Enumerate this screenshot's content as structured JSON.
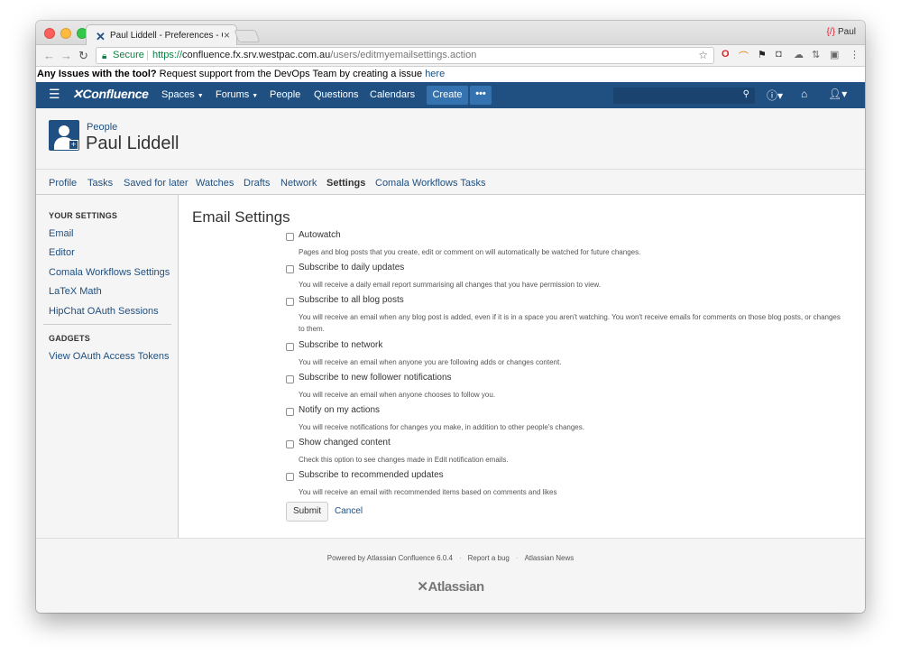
{
  "browser": {
    "tab_title": "Paul Liddell - Preferences - Co",
    "tab_close": "×",
    "profile_name": "Paul",
    "secure_label": "Secure",
    "url_scheme": "https://",
    "url_host": "confluence.fx.srv.westpac.com.au",
    "url_path": "/users/editmyemailsettings.action"
  },
  "banner": {
    "bold": "Any Issues with the tool?",
    "text": " Request support from the DevOps Team by creating a issue ",
    "link": "here"
  },
  "header": {
    "logo": "Confluence",
    "nav": [
      {
        "label": "Spaces",
        "caret": "▼"
      },
      {
        "label": "Forums",
        "caret": "▼"
      },
      {
        "label": "People"
      },
      {
        "label": "Questions"
      },
      {
        "label": "Calendars"
      }
    ],
    "create": "Create",
    "more": "•••",
    "search_placeholder": ""
  },
  "page": {
    "breadcrumb": "People",
    "title": "Paul Liddell"
  },
  "tabs": [
    "Profile",
    "Tasks",
    "Saved for later",
    "Watches",
    "Drafts",
    "Network",
    "Settings",
    "Comala Workflows Tasks"
  ],
  "active_tab": "Settings",
  "sidebar": {
    "settings_heading": "YOUR SETTINGS",
    "settings_links": [
      "Email",
      "Editor",
      "Comala Workflows Settings",
      "LaTeX Math",
      "HipChat OAuth Sessions"
    ],
    "gadgets_heading": "GADGETS",
    "gadgets_links": [
      "View OAuth Access Tokens"
    ]
  },
  "email_settings": {
    "heading": "Email Settings",
    "options": [
      {
        "label": "Autowatch",
        "checked": false,
        "desc": "Pages and blog posts that you create, edit or comment on will automatically be watched for future changes."
      },
      {
        "label": "Subscribe to daily updates",
        "checked": false,
        "desc": "You will receive a daily email report summarising all changes that you have permission to view."
      },
      {
        "label": "Subscribe to all blog posts",
        "checked": false,
        "desc": "You will receive an email when any blog post is added, even if it is in a space you aren't watching. You won't receive emails for comments on those blog posts, or changes to them."
      },
      {
        "label": "Subscribe to network",
        "checked": false,
        "desc": "You will receive an email when anyone you are following adds or changes content."
      },
      {
        "label": "Subscribe to new follower notifications",
        "checked": false,
        "desc": "You will receive an email when anyone chooses to follow you."
      },
      {
        "label": "Notify on my actions",
        "checked": false,
        "desc": "You will receive notifications for changes you make, in addition to other people's changes."
      },
      {
        "label": "Show changed content",
        "checked": false,
        "desc": "Check this option to see changes made in Edit notification emails."
      },
      {
        "label": "Subscribe to recommended updates",
        "checked": false,
        "desc": "You will receive an email with recommended items based on comments and likes"
      }
    ],
    "submit": "Submit",
    "cancel": "Cancel"
  },
  "footer": {
    "powered": "Powered by Atlassian Confluence 6.0.4",
    "report": "Report a bug",
    "news": "Atlassian News",
    "logo": "Atlassian"
  },
  "colors": {
    "header_blue": "#205081",
    "link_blue": "#205081",
    "button_blue": "#3572b0"
  }
}
